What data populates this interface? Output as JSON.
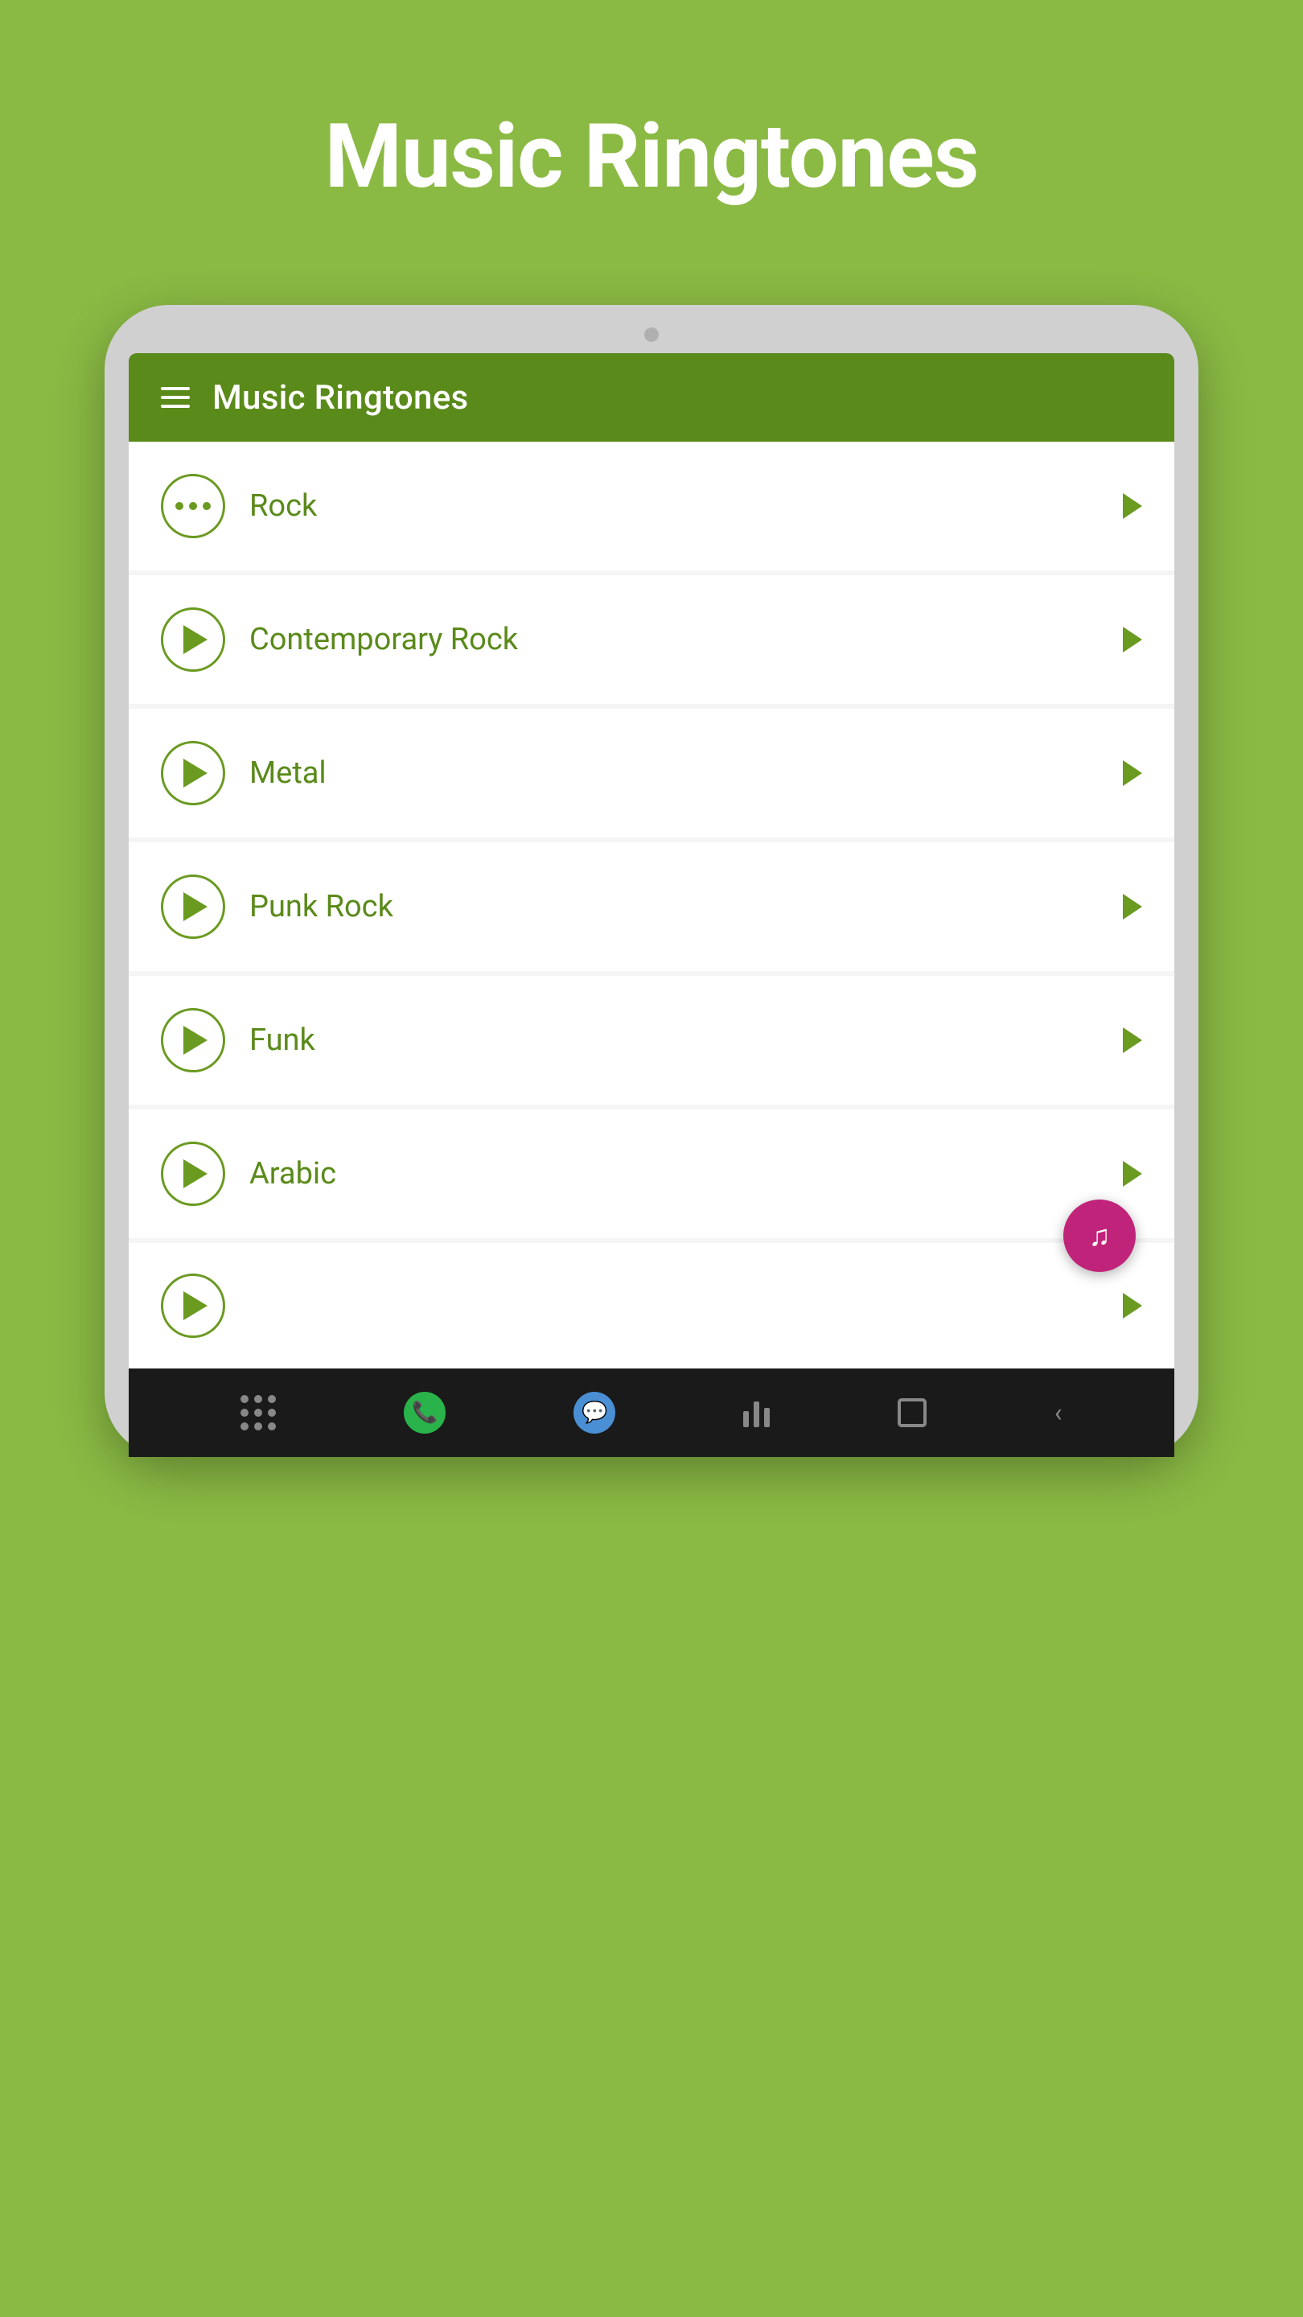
{
  "page": {
    "title": "Music Ringtones",
    "background_color": "#8aba44"
  },
  "app_bar": {
    "title": "Music Ringtones",
    "color": "#5a8a1a"
  },
  "list_items": [
    {
      "id": 1,
      "label": "Rock",
      "icon": "dots",
      "has_chevron": true
    },
    {
      "id": 2,
      "label": "Contemporary Rock",
      "icon": "play",
      "has_chevron": true
    },
    {
      "id": 3,
      "label": "Metal",
      "icon": "play",
      "has_chevron": true
    },
    {
      "id": 4,
      "label": "Punk Rock",
      "icon": "play",
      "has_chevron": true
    },
    {
      "id": 5,
      "label": "Funk",
      "icon": "play",
      "has_chevron": true
    },
    {
      "id": 6,
      "label": "Arabic",
      "icon": "play",
      "has_chevron": true
    }
  ],
  "bottom_nav": {
    "items": [
      "grid",
      "phone",
      "chat",
      "bars",
      "square",
      "back"
    ]
  },
  "fab": {
    "icon": "music-note",
    "color": "#c0247a"
  },
  "icons": {
    "hamburger": "☰",
    "play": "▶",
    "chevron": "❯",
    "music": "♪",
    "phone": "📞",
    "chat": "💬",
    "back": "‹"
  }
}
